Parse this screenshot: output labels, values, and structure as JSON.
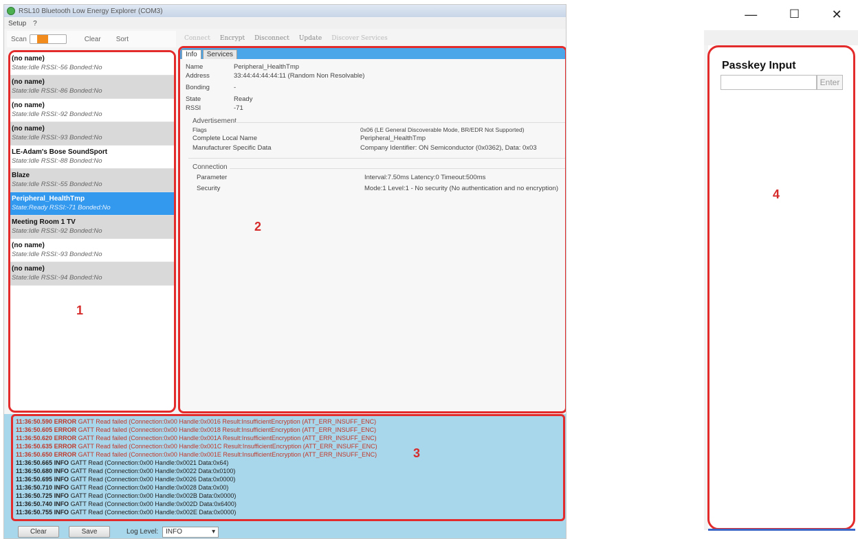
{
  "window": {
    "title": "RSL10 Bluetooth Low Energy Explorer (COM3)"
  },
  "menu": [
    "Setup",
    "?"
  ],
  "device_toolbar": {
    "scan": "Scan",
    "clear": "Clear",
    "sort": "Sort"
  },
  "devices": [
    {
      "name": "(no name)",
      "status": "State:Idle RSSI:-56 Bonded:No"
    },
    {
      "name": "(no name)",
      "status": "State:Idle RSSI:-86 Bonded:No"
    },
    {
      "name": "(no name)",
      "status": "State:Idle RSSI:-92 Bonded:No"
    },
    {
      "name": "(no name)",
      "status": "State:Idle RSSI:-93 Bonded:No"
    },
    {
      "name": "LE-Adam's Bose SoundSport",
      "status": "State:Idle RSSI:-88 Bonded:No"
    },
    {
      "name": "Blaze",
      "status": "State:Idle RSSI:-55 Bonded:No"
    },
    {
      "name": "Peripheral_HealthTmp",
      "status": "State:Ready RSSI:-71 Bonded:No"
    },
    {
      "name": "Meeting Room 1 TV",
      "status": "State:Idle RSSI:-92 Bonded:No"
    },
    {
      "name": "(no name)",
      "status": "State:Idle RSSI:-93 Bonded:No"
    },
    {
      "name": "(no name)",
      "status": "State:Idle RSSI:-94 Bonded:No"
    }
  ],
  "actions": {
    "connect": "Connect",
    "encrypt": "Encrypt",
    "disconnect": "Disconnect",
    "update": "Update",
    "discover": "Discover Services"
  },
  "tabs": {
    "info": "Info",
    "services": "Services"
  },
  "info": {
    "name_label": "Name",
    "name_value": "Peripheral_HealthTmp",
    "address_label": "Address",
    "address_value": "33:44:44:44:44:11 (Random Non Resolvable)",
    "bonding_label": "Bonding",
    "bonding_value": "-",
    "state_label": "State",
    "state_value": "Ready",
    "rssi_label": "RSSI",
    "rssi_value": "-71"
  },
  "advertisement": {
    "title": "Advertisement",
    "flags_label": "Flags",
    "flags_value": "0x06 (LE General Discoverable Mode, BR/EDR Not Supported)",
    "local_name_label": "Complete Local Name",
    "local_name_value": "Peripheral_HealthTmp",
    "manufacturer_label": "Manufacturer Specific Data",
    "manufacturer_value": "Company Identifier: ON Semiconductor (0x0362), Data: 0x03"
  },
  "connection": {
    "title": "Connection",
    "parameter_label": "Parameter",
    "parameter_value": "Interval:7.50ms Latency:0 Timeout:500ms",
    "security_label": "Security",
    "security_value": "Mode:1 Level:1 - No security (No authentication and no encryption)"
  },
  "log": [
    {
      "time": "11:36:50.590",
      "level": "ERROR",
      "msg": "GATT Read failed (Connection:0x00 Handle:0x0016 Result:InsufficientEncryption (ATT_ERR_INSUFF_ENC)"
    },
    {
      "time": "11:36:50.605",
      "level": "ERROR",
      "msg": "GATT Read failed (Connection:0x00 Handle:0x0018 Result:InsufficientEncryption (ATT_ERR_INSUFF_ENC)"
    },
    {
      "time": "11:36:50.620",
      "level": "ERROR",
      "msg": "GATT Read failed (Connection:0x00 Handle:0x001A Result:InsufficientEncryption (ATT_ERR_INSUFF_ENC)"
    },
    {
      "time": "11:36:50.635",
      "level": "ERROR",
      "msg": "GATT Read failed (Connection:0x00 Handle:0x001C Result:InsufficientEncryption (ATT_ERR_INSUFF_ENC)"
    },
    {
      "time": "11:36:50.650",
      "level": "ERROR",
      "msg": "GATT Read failed (Connection:0x00 Handle:0x001E Result:InsufficientEncryption (ATT_ERR_INSUFF_ENC)"
    },
    {
      "time": "11:36:50.665",
      "level": "INFO",
      "msg": "GATT Read (Connection:0x00 Handle:0x0021 Data:0x64)"
    },
    {
      "time": "11:36:50.680",
      "level": "INFO",
      "msg": "GATT Read (Connection:0x00 Handle:0x0022 Data:0x0100)"
    },
    {
      "time": "11:36:50.695",
      "level": "INFO",
      "msg": "GATT Read (Connection:0x00 Handle:0x0026 Data:0x0000)"
    },
    {
      "time": "11:36:50.710",
      "level": "INFO",
      "msg": "GATT Read (Connection:0x00 Handle:0x0028 Data:0x00)"
    },
    {
      "time": "11:36:50.725",
      "level": "INFO",
      "msg": "GATT Read (Connection:0x00 Handle:0x002B Data:0x0000)"
    },
    {
      "time": "11:36:50.740",
      "level": "INFO",
      "msg": "GATT Read (Connection:0x00 Handle:0x002D Data:0x6400)"
    },
    {
      "time": "11:36:50.755",
      "level": "INFO",
      "msg": "GATT Read (Connection:0x00 Handle:0x002E Data:0x0000)"
    }
  ],
  "log_controls": {
    "clear": "Clear",
    "save": "Save",
    "level_label": "Log Level:",
    "level_value": "INFO"
  },
  "markers": {
    "m1": "1",
    "m2": "2",
    "m3": "3",
    "m4": "4"
  },
  "passkey": {
    "title": "Passkey Input",
    "input_value": "",
    "enter": "Enter"
  },
  "colors": {
    "highlight": "#e32b2b",
    "selected_row": "#3399ee",
    "log_bg": "#a8d6ea",
    "error_text": "#c0392b"
  }
}
